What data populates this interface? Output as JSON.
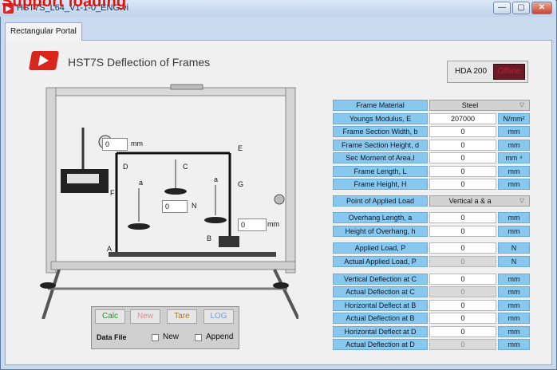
{
  "caption": "Support loading",
  "window": {
    "title": "HST7S_L64_V1-1-0_ENG.vi",
    "min": "—",
    "max": "▢",
    "close": "✕"
  },
  "tab": {
    "label": "Rectangular Portal"
  },
  "app": {
    "title": "HST7S  Deflection of Frames",
    "hda": "HDA 200",
    "status": "Offline"
  },
  "rig": {
    "top_value": "0",
    "top_unit": "mm",
    "mid_value": "0",
    "mid_unit": "N",
    "right_value": "0",
    "right_unit": "mm",
    "labels": {
      "A": "A",
      "B": "B",
      "C": "C",
      "D": "D",
      "E": "E",
      "F": "F",
      "G": "G",
      "a1": "a",
      "a2": "a"
    }
  },
  "params": [
    {
      "label": "Frame Material",
      "value": "Steel",
      "kind": "select"
    },
    {
      "label": "Youngs Modulus, E",
      "value": "207000",
      "unit": "N/mm²"
    },
    {
      "label": "Frame Section Width, b",
      "value": "0",
      "unit": "mm"
    },
    {
      "label": "Frame Section Height, d",
      "value": "0",
      "unit": "mm"
    },
    {
      "label": "Sec Moment of Area,I",
      "value": "0",
      "unit": "mm ⁴"
    },
    {
      "label": "Frame Length, L",
      "value": "0",
      "unit": "mm"
    },
    {
      "label": "Frame Height, H",
      "value": "0",
      "unit": "mm"
    },
    {
      "label": "Point of Applied Load",
      "value": "Vertical a & a",
      "kind": "select"
    },
    {
      "label": "Overhang Length, a",
      "value": "0",
      "unit": "mm"
    },
    {
      "label": "Height of Overhang, h",
      "value": "0",
      "unit": "mm"
    },
    {
      "label": "Applied Load, P",
      "value": "0",
      "unit": "N"
    },
    {
      "label": "Actual Applied Load, P",
      "value": "0",
      "unit": "N",
      "grey": true
    },
    {
      "label": "Vertical Deflection at C",
      "value": "0",
      "unit": "mm"
    },
    {
      "label": "Actual Deflection at C",
      "value": "0",
      "unit": "mm",
      "grey": true
    },
    {
      "label": "Horizontal Deflect at B",
      "value": "0",
      "unit": "mm"
    },
    {
      "label": "Actual Deflection at B",
      "value": "0",
      "unit": "mm"
    },
    {
      "label": "Horizontal Deflect at D",
      "value": "0",
      "unit": "mm"
    },
    {
      "label": "Actual Deflection at D",
      "value": "0",
      "unit": "mm",
      "grey": true
    }
  ],
  "controls": {
    "calc": "Calc",
    "new": "New",
    "tare": "Tare",
    "log": "LOG",
    "data_file": "Data File",
    "new_chk": "New",
    "append_chk": "Append"
  },
  "colors": {
    "label_bg": "#88c8ee",
    "accent": "#d9261c"
  }
}
